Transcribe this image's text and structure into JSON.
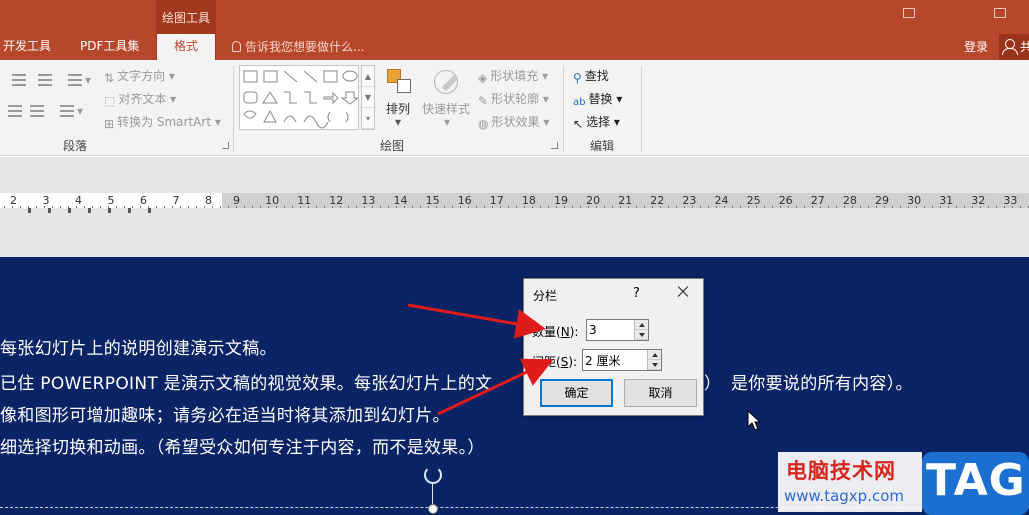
{
  "titlebar": {
    "context_group": "绘图工具",
    "tabs": [
      "开发工具",
      "PDF工具集",
      "格式"
    ],
    "active_tab": "格式",
    "tell_me": "告诉我您想要做什么...",
    "login": "登录",
    "share_partial": "共"
  },
  "ribbon": {
    "paragraph": {
      "label": "段落",
      "text_direction": "文字方向",
      "align_text": "对齐文本",
      "convert_smartart": "转换为 SmartArt"
    },
    "drawing": {
      "label": "绘图",
      "arrange": "排列",
      "quick_styles": "快速样式",
      "shape_fill": "形状填充",
      "shape_outline": "形状轮廓",
      "shape_effects": "形状效果"
    },
    "editing": {
      "label": "编辑",
      "find": "查找",
      "replace": "替换",
      "select": "选择"
    }
  },
  "ruler": {
    "left_numbers": [
      "2",
      "3",
      "4",
      "5",
      "6",
      "7",
      "8"
    ],
    "right_numbers": [
      "9",
      "10",
      "11",
      "12",
      "13",
      "14",
      "15",
      "16",
      "17",
      "18",
      "19",
      "20",
      "21",
      "22",
      "23",
      "24",
      "25",
      "26",
      "27",
      "28",
      "29",
      "30",
      "31",
      "32",
      "33"
    ]
  },
  "slide": {
    "lines": [
      "每张幻灯片上的说明创建演示文稿。",
      "已住 POWERPOINT 是演示文稿的视觉效果。每张幻灯片上的文",
      "像和图形可增加趣味；请务必在适当时将其添加到幻灯片。",
      "细选择切换和动画。（希望受众如何专注于内容，而不是效果。）"
    ],
    "line2_tail": "是你要说的所有内容）。",
    "line2_tail_prefix": "）"
  },
  "dialog": {
    "title": "分栏",
    "help": "?",
    "count_label": "数量",
    "count_key": "N",
    "count_value": "3",
    "spacing_label": "间距",
    "spacing_key": "S",
    "spacing_value": "2 厘米",
    "ok": "确定",
    "cancel": "取消"
  },
  "watermark": {
    "site_name": "电脑技术网",
    "url": "www.tagxp.com",
    "tag": "TAG"
  },
  "colors": {
    "accent": "#b7472a",
    "slide_bg": "#0b2466",
    "arrow": "#e01b1b"
  }
}
